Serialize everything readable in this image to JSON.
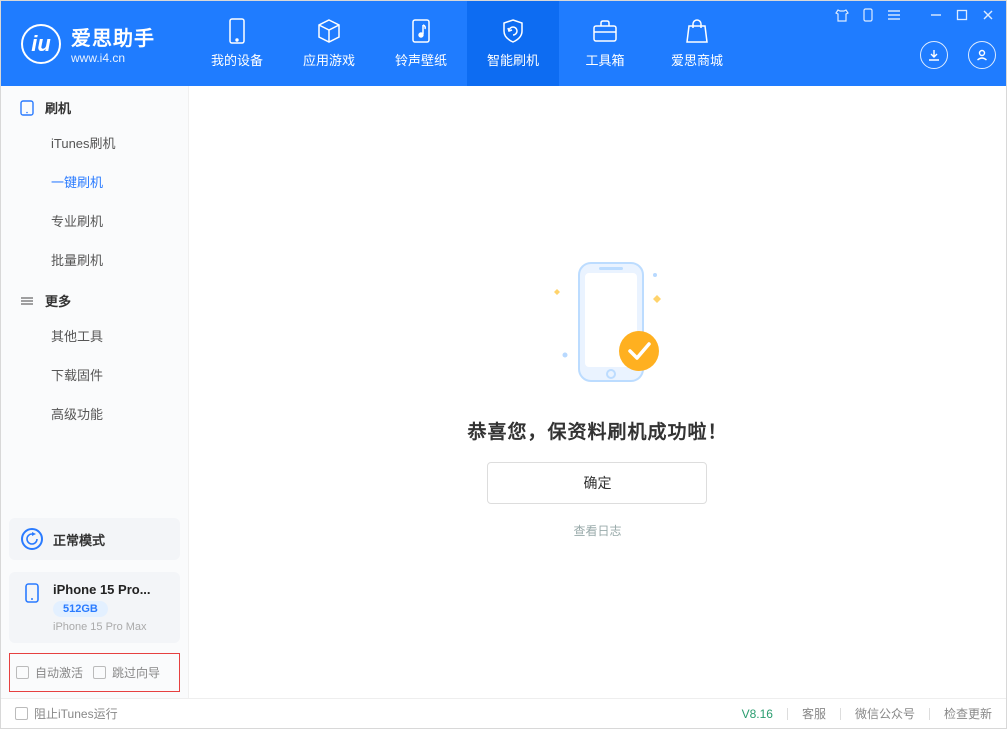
{
  "app": {
    "name": "爱思助手",
    "url": "www.i4.cn",
    "version": "V8.16"
  },
  "nav": [
    {
      "label": "我的设备"
    },
    {
      "label": "应用游戏"
    },
    {
      "label": "铃声壁纸"
    },
    {
      "label": "智能刷机"
    },
    {
      "label": "工具箱"
    },
    {
      "label": "爱思商城"
    }
  ],
  "sidebar": {
    "group1": {
      "title": "刷机",
      "items": [
        "iTunes刷机",
        "一键刷机",
        "专业刷机",
        "批量刷机"
      ]
    },
    "group2": {
      "title": "更多",
      "items": [
        "其他工具",
        "下载固件",
        "高级功能"
      ]
    }
  },
  "status": {
    "label": "正常模式"
  },
  "device": {
    "name": "iPhone 15 Pro...",
    "capacity": "512GB",
    "model": "iPhone 15 Pro Max"
  },
  "options": {
    "auto_activate": "自动激活",
    "skip_wizard": "跳过向导"
  },
  "main": {
    "headline": "恭喜您，保资料刷机成功啦！",
    "confirm": "确定",
    "view_log": "查看日志"
  },
  "footer": {
    "block_itunes": "阻止iTunes运行",
    "support": "客服",
    "wechat": "微信公众号",
    "check_update": "检查更新"
  }
}
